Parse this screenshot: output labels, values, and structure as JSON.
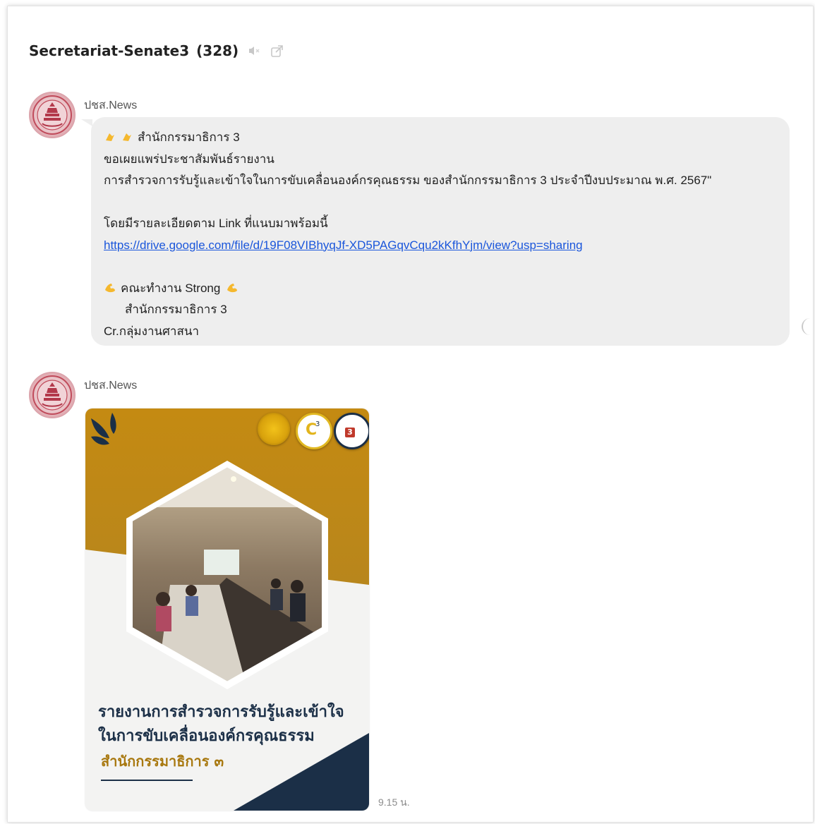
{
  "chat": {
    "title": "Secretariat-Senate3",
    "member_count": "(328)",
    "icons": [
      "speaker-muted-icon",
      "popout-icon"
    ]
  },
  "messages": [
    {
      "sender": "ปชส.News",
      "lines": {
        "l1": "สำนักกรรมาธิการ 3",
        "l2": "ขอเผยแพร่ประชาสัมพันธ์รายงาน",
        "l3": "การสำรวจการรับรู้และเข้าใจในการขับเคลื่อนองค์กรคุณธรรม ของสำนักกรรมาธิการ 3 ประจำปีงบประมาณ พ.ศ. 2567\"",
        "l4": "โดยมีรายละเอียดตาม Link ที่แนบมาพร้อมนี้",
        "link": "https://drive.google.com/file/d/19F08VIBhyqJf-XD5PAGqvCqu2kKfhYjm/view?usp=sharing",
        "l5": "คณะทำงาน Strong",
        "l6": "สำนักกรรมาธิการ 3",
        "l7": "Cr.กลุ่มงานศาสนา"
      }
    },
    {
      "sender": "ปชส.News",
      "image": {
        "title_line1": "รายงานการสำรวจการรับรู้และเข้าใจ",
        "title_line2": "ในการขับเคลื่อนองค์กรคุณธรรม",
        "subtitle": "สำนักกรรมาธิการ ๓",
        "badge_right": "3",
        "colors": {
          "gold": "#c48a12",
          "navy": "#1b2f47",
          "light": "#f3f3f2"
        }
      },
      "time": "9.15 น."
    }
  ]
}
